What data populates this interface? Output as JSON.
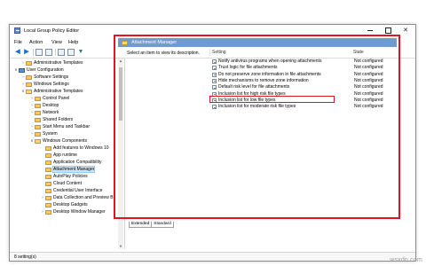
{
  "window": {
    "title": "Local Group Policy Editor",
    "controls": {
      "minimize": "minimize",
      "maximize": "maximize",
      "close": "✕"
    }
  },
  "menu": [
    "File",
    "Action",
    "View",
    "Help"
  ],
  "toolbar": {
    "icons": [
      "back-arrow-icon",
      "forward-arrow-icon",
      "show-hide-tree-icon",
      "properties-icon",
      "export-list-icon",
      "help-icon",
      "filter-icon"
    ]
  },
  "tree": [
    {
      "label": "Administrative Templates",
      "level": 1,
      "expander": ">",
      "icon": "folder",
      "selected": false
    },
    {
      "label": "User Configuration",
      "level": 0,
      "expander": "v",
      "icon": "pc",
      "selected": false
    },
    {
      "label": "Software Settings",
      "level": 1,
      "expander": ">",
      "icon": "folder",
      "selected": false
    },
    {
      "label": "Windows Settings",
      "level": 1,
      "expander": ">",
      "icon": "folder",
      "selected": false
    },
    {
      "label": "Administrative Templates",
      "level": 1,
      "expander": "v",
      "icon": "folder",
      "selected": false
    },
    {
      "label": "Control Panel",
      "level": 2,
      "expander": ">",
      "icon": "folder",
      "selected": false
    },
    {
      "label": "Desktop",
      "level": 2,
      "expander": ">",
      "icon": "folder",
      "selected": false
    },
    {
      "label": "Network",
      "level": 2,
      "expander": ">",
      "icon": "folder",
      "selected": false
    },
    {
      "label": "Shared Folders",
      "level": 2,
      "expander": "",
      "icon": "folder",
      "selected": false
    },
    {
      "label": "Start Menu and Taskbar",
      "level": 2,
      "expander": ">",
      "icon": "folder",
      "selected": false
    },
    {
      "label": "System",
      "level": 2,
      "expander": ">",
      "icon": "folder",
      "selected": false
    },
    {
      "label": "Windows Components",
      "level": 2,
      "expander": "v",
      "icon": "folder",
      "selected": false
    },
    {
      "label": "Add features to Windows 10",
      "level": 3,
      "expander": "",
      "icon": "folder",
      "selected": false
    },
    {
      "label": "App runtime",
      "level": 3,
      "expander": "",
      "icon": "folder",
      "selected": false
    },
    {
      "label": "Application Compatibility",
      "level": 3,
      "expander": "",
      "icon": "folder",
      "selected": false
    },
    {
      "label": "Attachment Manager",
      "level": 3,
      "expander": "",
      "icon": "folder",
      "selected": true
    },
    {
      "label": "AutoPlay Policies",
      "level": 3,
      "expander": "",
      "icon": "folder",
      "selected": false
    },
    {
      "label": "Cloud Content",
      "level": 3,
      "expander": "",
      "icon": "folder",
      "selected": false
    },
    {
      "label": "Credential User Interface",
      "level": 3,
      "expander": "",
      "icon": "folder",
      "selected": false
    },
    {
      "label": "Data Collection and Preview B",
      "level": 3,
      "expander": ">",
      "icon": "folder",
      "selected": false
    },
    {
      "label": "Desktop Gadgets",
      "level": 3,
      "expander": "",
      "icon": "folder",
      "selected": false
    },
    {
      "label": "Desktop Window Manager",
      "level": 3,
      "expander": ">",
      "icon": "folder",
      "selected": false
    }
  ],
  "pane": {
    "title": "Attachment Manager",
    "description": "Select an item to view its description.",
    "columns": {
      "setting": "Setting",
      "state": "State"
    },
    "settings": [
      {
        "name": "Notify antivirus programs when opening attachments",
        "state": "Not configured"
      },
      {
        "name": "Trust logic for file attachments",
        "state": "Not configured"
      },
      {
        "name": "Do not preserve zone information in file attachments",
        "state": "Not configured"
      },
      {
        "name": "Hide mechanisms to remove zone information",
        "state": "Not configured"
      },
      {
        "name": "Default risk level for file attachments",
        "state": "Not configured"
      },
      {
        "name": "Inclusion list for high risk file types",
        "state": "Not configured"
      },
      {
        "name": "Inclusion list for low file types",
        "state": "Not configured"
      },
      {
        "name": "Inclusion list for moderate risk file types",
        "state": "Not configured"
      }
    ]
  },
  "tabs": [
    "Extended",
    "Standard"
  ],
  "status": "8 setting(s)",
  "watermark": "wsxdn.com",
  "colors": {
    "highlight_red": "#e0151f",
    "pane_header": "#6f9bd1",
    "selection": "#cce4f7"
  }
}
